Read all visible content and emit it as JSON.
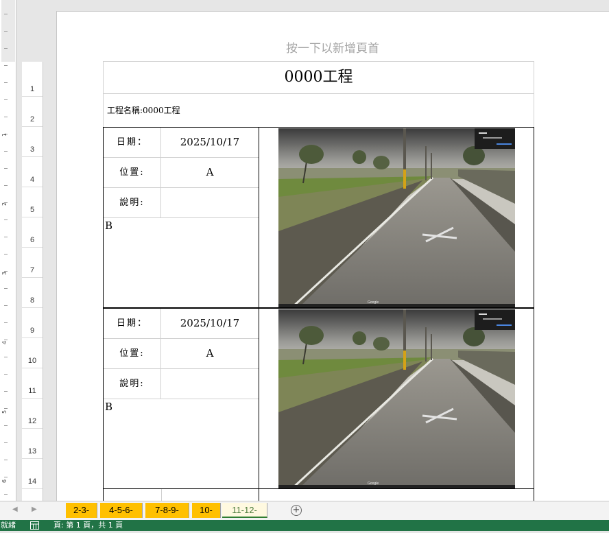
{
  "page": {
    "header_hint": "按一下以新增頁首",
    "title": "0000工程",
    "project_name": "工程名稱:0000工程"
  },
  "row_numbers": [
    "1",
    "2",
    "3",
    "4",
    "5",
    "6",
    "7",
    "8",
    "9",
    "10",
    "11",
    "12",
    "13",
    "14"
  ],
  "ruler_numbers": [
    "1",
    "2",
    "3",
    "4",
    "5",
    "6"
  ],
  "records": [
    {
      "date_label": "日期：",
      "date_value": "2025/10/17",
      "location_label": "位置:",
      "location_value": "A",
      "note_label": "說明:",
      "description": "B"
    },
    {
      "date_label": "日期：",
      "date_value": "2025/10/17",
      "location_label": "位置:",
      "location_value": "A",
      "note_label": "說明:",
      "description": "B"
    }
  ],
  "sheet_tabs": [
    "2-3-",
    "4-5-6-",
    "7-8-9-",
    "10-",
    "11-12-"
  ],
  "active_tab": "11-12-",
  "add_sheet_symbol": "+",
  "nav": {
    "prev": "◀",
    "next": "▶"
  },
  "status": {
    "ready": "就緒",
    "page_info": "頁: 第 1 頁，共 1 頁",
    "page_icon": "page-view-icon"
  },
  "colors": {
    "tab_fill": "#ffc000",
    "status_bar": "#217346",
    "header_hint": "#a6a6a6"
  },
  "photo": {
    "alt": "Google",
    "icon": "street-view-photo"
  }
}
